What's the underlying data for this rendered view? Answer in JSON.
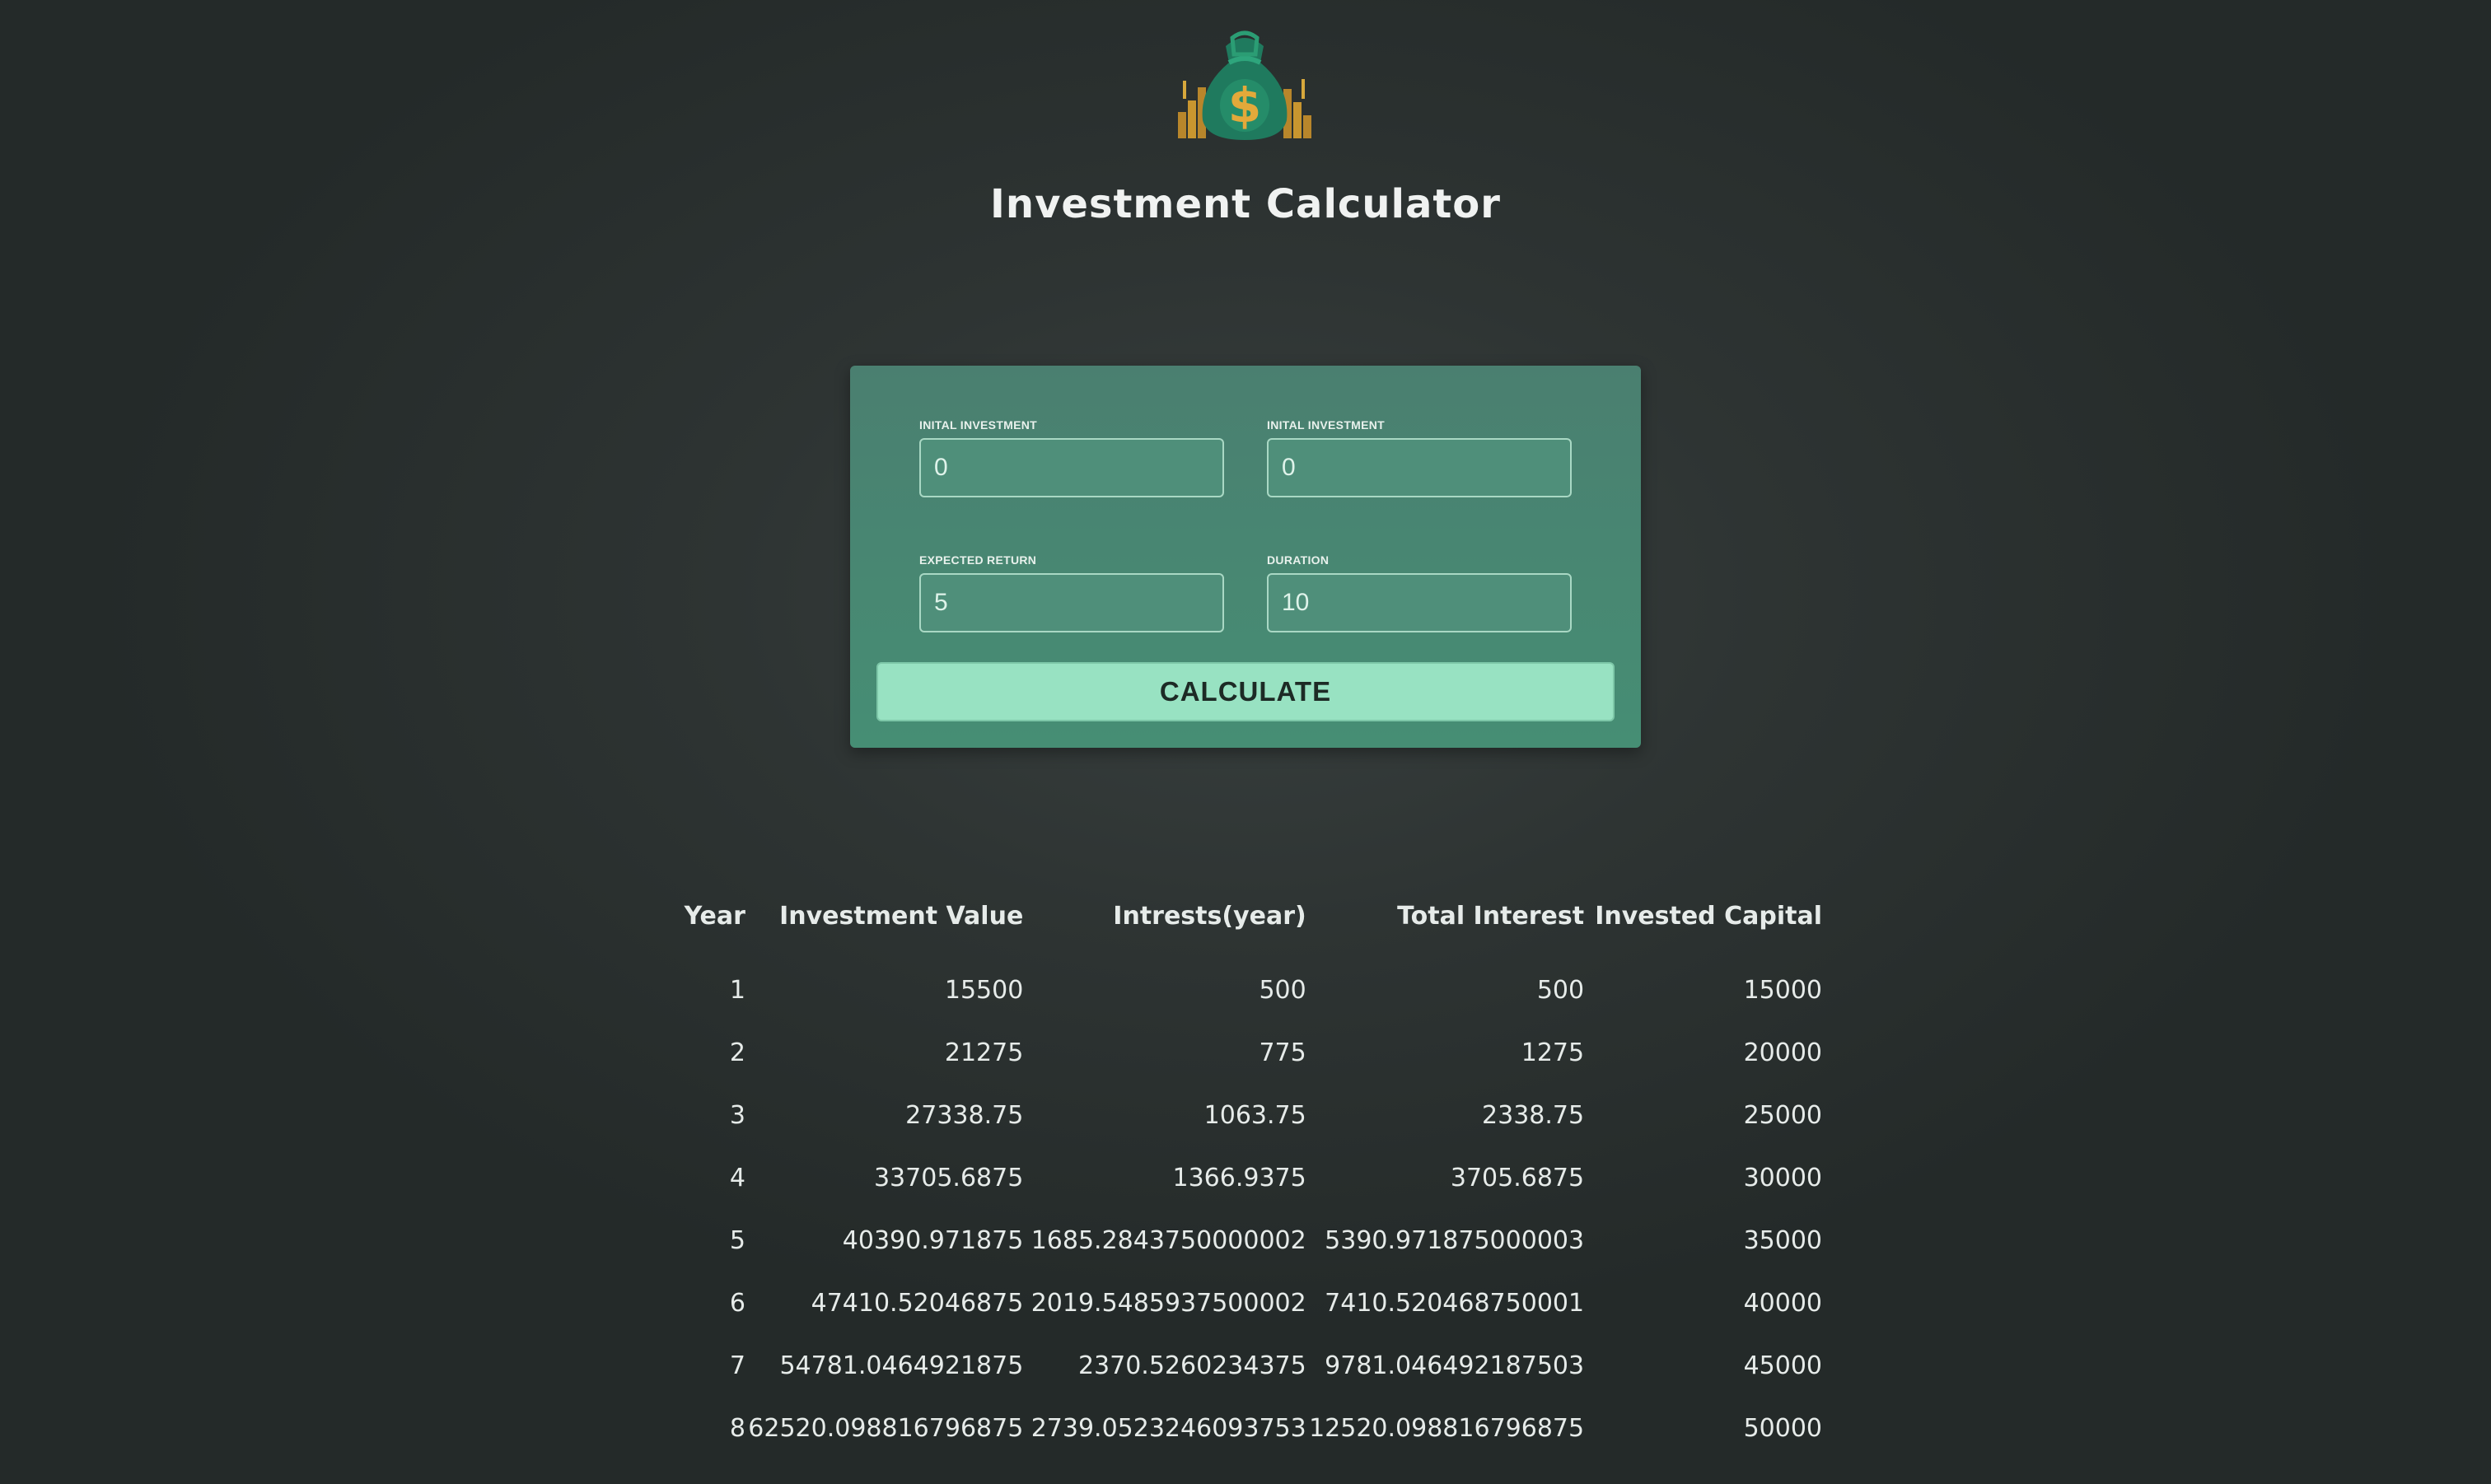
{
  "app": {
    "title": "Investment Calculator",
    "logo_icon": "money-bag-dollar-icon"
  },
  "form": {
    "fields": [
      {
        "label": "INITAL INVESTMENT",
        "value": "0"
      },
      {
        "label": "INITAL INVESTMENT",
        "value": "0"
      },
      {
        "label": "EXPECTED RETURN",
        "value": "5"
      },
      {
        "label": "DURATION",
        "value": "10"
      }
    ],
    "button_label": "CALCULATE"
  },
  "table": {
    "headers": [
      "Year",
      "Investment Value",
      "Intrests(year)",
      "Total Interest",
      "Invested Capital"
    ],
    "rows": [
      [
        "1",
        "15500",
        "500",
        "500",
        "15000"
      ],
      [
        "2",
        "21275",
        "775",
        "1275",
        "20000"
      ],
      [
        "3",
        "27338.75",
        "1063.75",
        "2338.75",
        "25000"
      ],
      [
        "4",
        "33705.6875",
        "1366.9375",
        "3705.6875",
        "30000"
      ],
      [
        "5",
        "40390.971875",
        "1685.2843750000002",
        "5390.971875000003",
        "35000"
      ],
      [
        "6",
        "47410.52046875",
        "2019.5485937500002",
        "7410.520468750001",
        "40000"
      ],
      [
        "7",
        "54781.0464921875",
        "2370.5260234375",
        "9781.046492187503",
        "45000"
      ],
      [
        "8",
        "62520.098816796875",
        "2739.0523246093753",
        "12520.098816796875",
        "50000"
      ]
    ]
  },
  "colors": {
    "background": "#2e3433",
    "card": "#4a8a74",
    "button": "#98e2c2",
    "text": "#e6ebe9"
  }
}
